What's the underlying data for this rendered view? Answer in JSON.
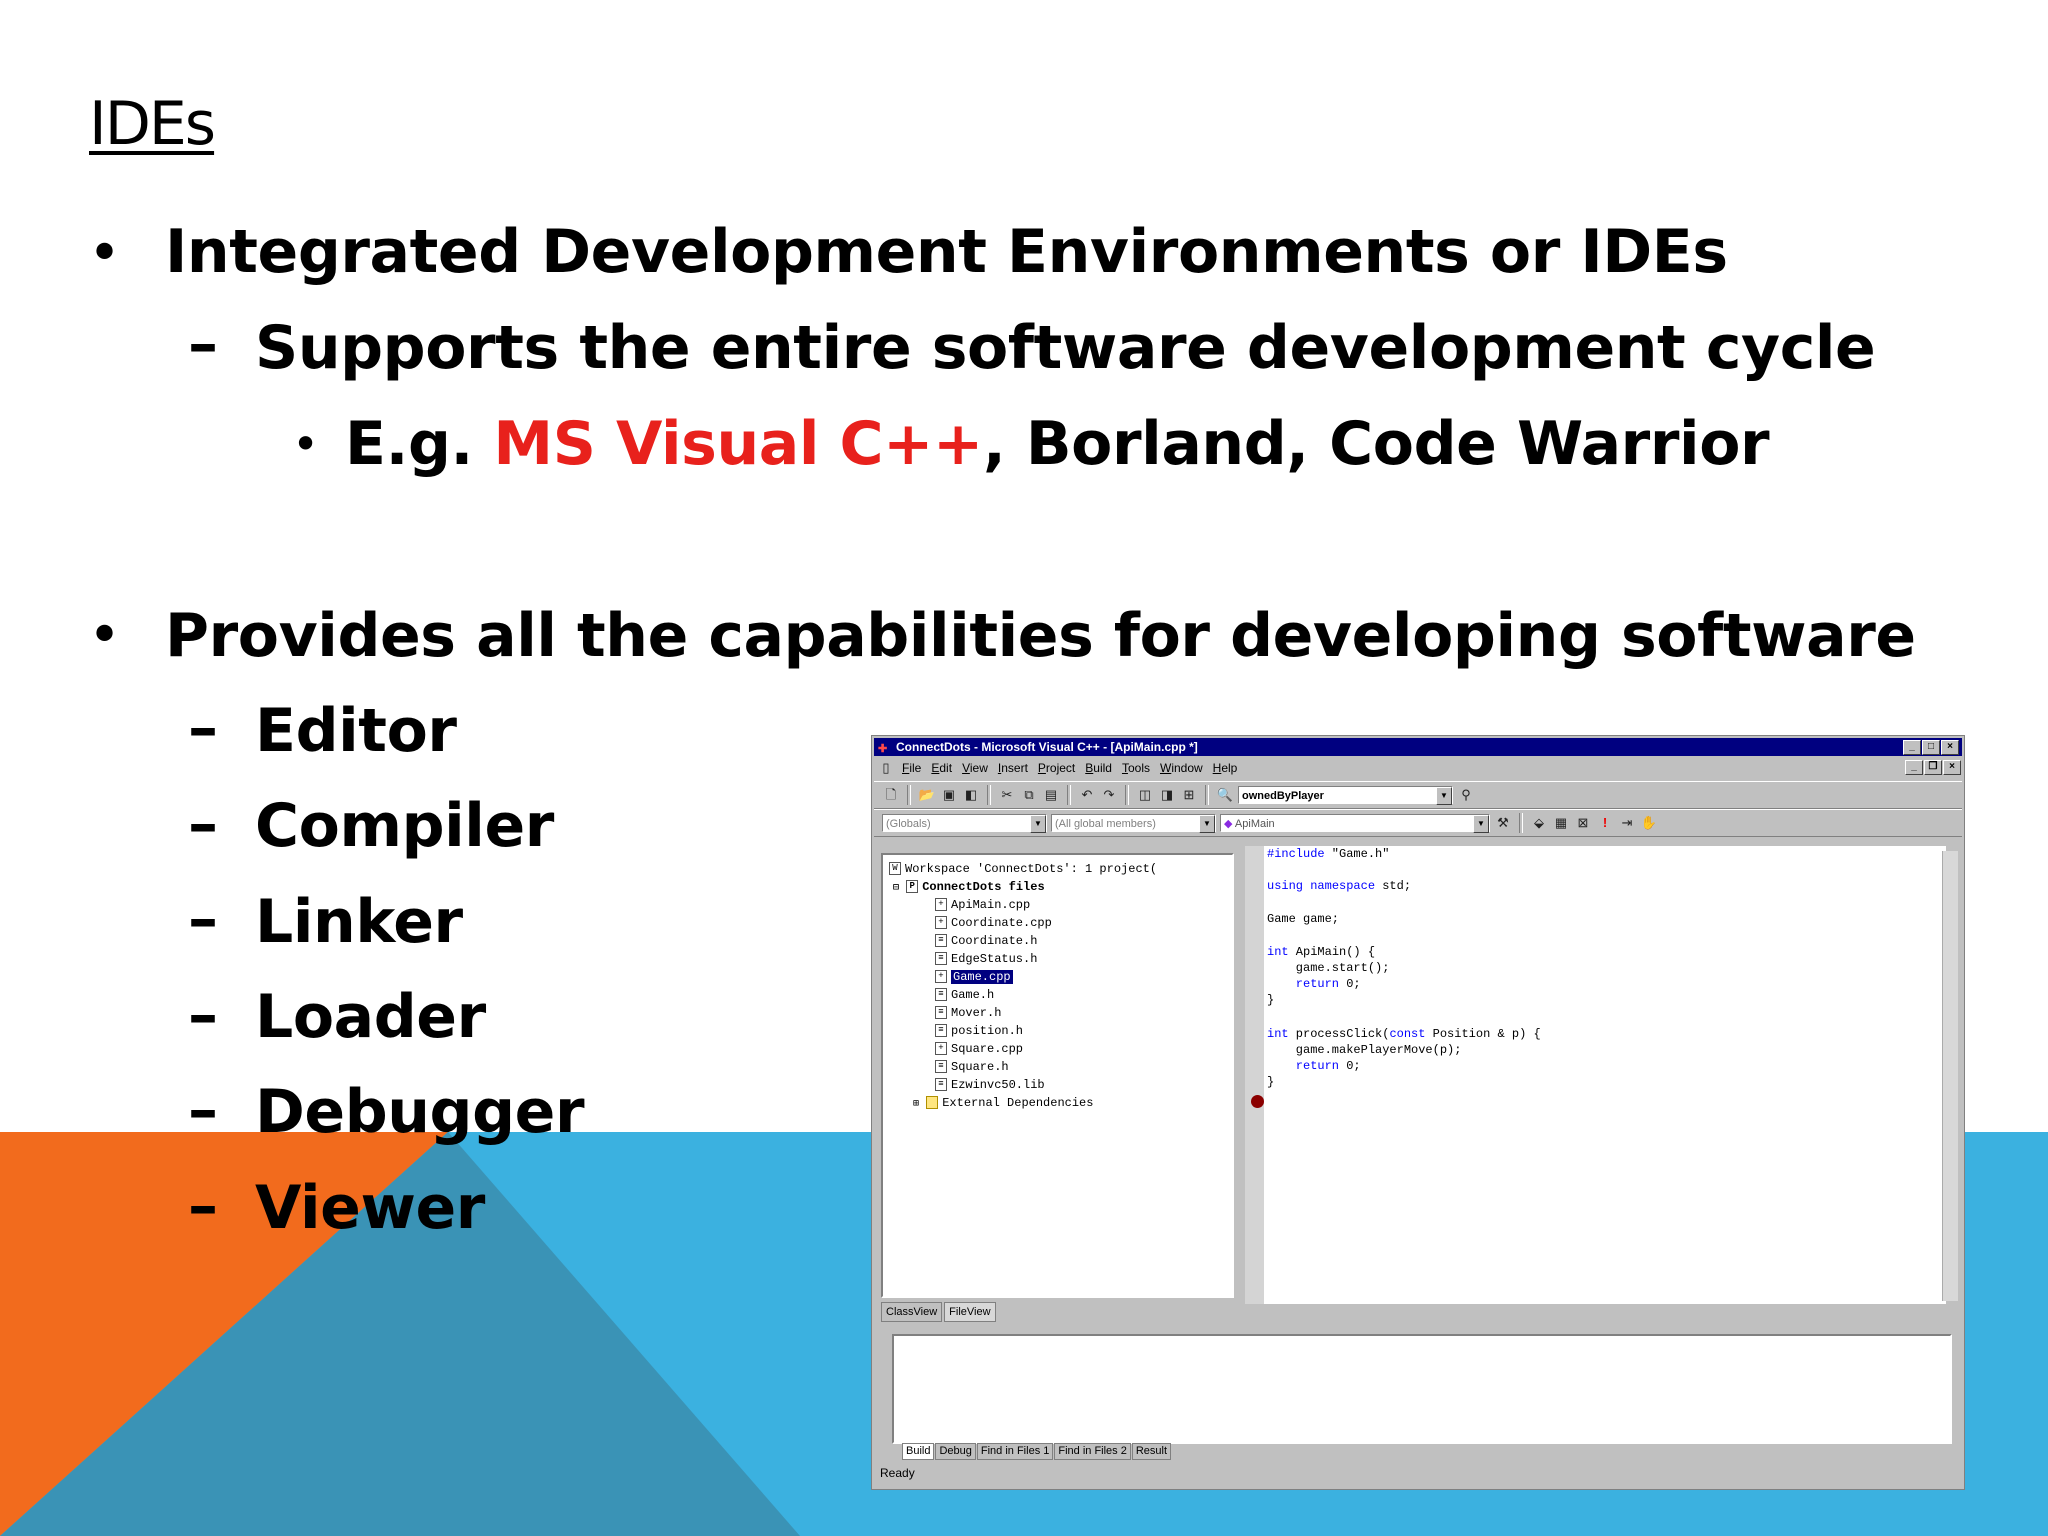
{
  "slide": {
    "title": "IDEs",
    "bullet1": "Integrated Development Environments or IDEs",
    "sub1": "Supports the entire software development cycle",
    "eg_prefix": "E.g. ",
    "eg_highlight": "MS Visual C++",
    "eg_rest": ", Borland, Code Warrior",
    "bullet2": "Provides all the capabilities for developing software",
    "items": [
      "Editor",
      "Compiler",
      "Linker",
      "Loader",
      "Debugger",
      "Viewer"
    ],
    "colors": {
      "highlight": "#e8211c",
      "orange": "#f26b1d",
      "blue": "#3bb1e0",
      "dark_blue": "#3a93b6"
    }
  },
  "ide": {
    "window_title": "ConnectDots - Microsoft Visual C++ - [ApiMain.cpp *]",
    "menu": [
      "File",
      "Edit",
      "View",
      "Insert",
      "Project",
      "Build",
      "Tools",
      "Window",
      "Help"
    ],
    "find_combo": "ownedByPlayer",
    "class_combo": "(Globals)",
    "members_combo": "(All global members)",
    "func_combo": "ApiMain",
    "workspace_root": "Workspace 'ConnectDots': 1 project(",
    "project": "ConnectDots files",
    "files": [
      "ApiMain.cpp",
      "Coordinate.cpp",
      "Coordinate.h",
      "EdgeStatus.h",
      "Game.cpp",
      "Game.h",
      "Mover.h",
      "position.h",
      "Square.cpp",
      "Square.h",
      "Ezwinvc50.lib",
      "External Dependencies"
    ],
    "selected_file": "Game.cpp",
    "pane_tabs": [
      "ClassView",
      "FileView"
    ],
    "code": {
      "l1a": "#include",
      "l1b": " \"Game.h\"",
      "l2a": "using",
      "l2b": " ",
      "l2c": "namespace",
      "l2d": " std;",
      "l3": "Game game;",
      "l4a": "int",
      "l4b": " ApiMain() {",
      "l5": "    game.start();",
      "l6a": "    return",
      "l6b": " 0;",
      "l7": "}",
      "l8a": "int",
      "l8b": " processClick(",
      "l8c": "const",
      "l8d": " Position & p) {",
      "l9": "    game.makePlayerMove(p);",
      "l10a": "    return",
      "l10b": " 0;",
      "l11": "}"
    },
    "output_tabs": [
      "Build",
      "Debug",
      "Find in Files 1",
      "Find in Files 2",
      "Result"
    ],
    "status": "Ready"
  }
}
